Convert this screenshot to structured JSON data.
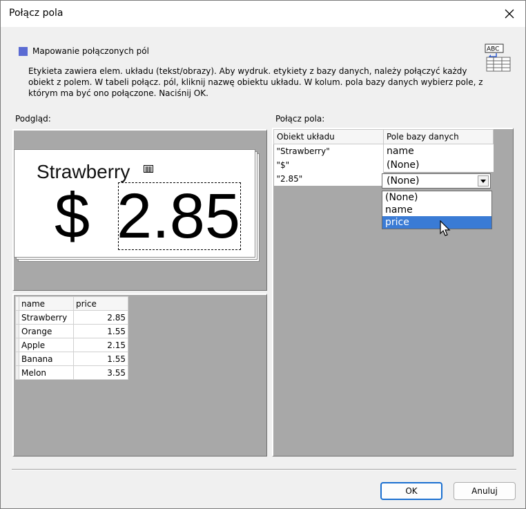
{
  "window": {
    "title": "Połącz pola"
  },
  "section": {
    "heading": "Mapowanie połączonych pól",
    "description": "Etykieta zawiera elem. układu (tekst/obrazy). Aby wydruk. etykiety z bazy danych, należy połączyć każdy obiekt z polem. W tabeli połącz. pól, kliknij nazwę obiektu układu. W kolum. pola bazy danych wybierz pole, z którym ma być ono połączone. Naciśnij OK."
  },
  "abc_icon_text": "ABC",
  "preview": {
    "label": "Podgląd:",
    "card": {
      "name_text": "Strawberry",
      "currency": "$",
      "price_text": "2.85"
    }
  },
  "database": {
    "columns": [
      "name",
      "price"
    ],
    "rows": [
      {
        "name": "Strawberry",
        "price": "2.85"
      },
      {
        "name": "Orange",
        "price": "1.55"
      },
      {
        "name": "Apple",
        "price": "2.15"
      },
      {
        "name": "Banana",
        "price": "1.55"
      },
      {
        "name": "Melon",
        "price": "3.55"
      }
    ]
  },
  "mapping": {
    "label": "Połącz pola:",
    "headers": [
      "Obiekt układu",
      "Pole bazy danych"
    ],
    "rows": [
      {
        "object": "\"Strawberry\"",
        "field": "name"
      },
      {
        "object": "\"$\"",
        "field": "(None)"
      },
      {
        "object": "\"2.85\"",
        "field": ""
      }
    ],
    "dropdown": {
      "selected": "(None)",
      "options": [
        "(None)",
        "name",
        "price"
      ],
      "highlighted": "price"
    }
  },
  "buttons": {
    "ok": "OK",
    "cancel": "Anuluj"
  },
  "colors": {
    "accent": "#3a7bd5",
    "section_square": "#5b6bd3",
    "panel_grey": "#a8a8a8"
  }
}
